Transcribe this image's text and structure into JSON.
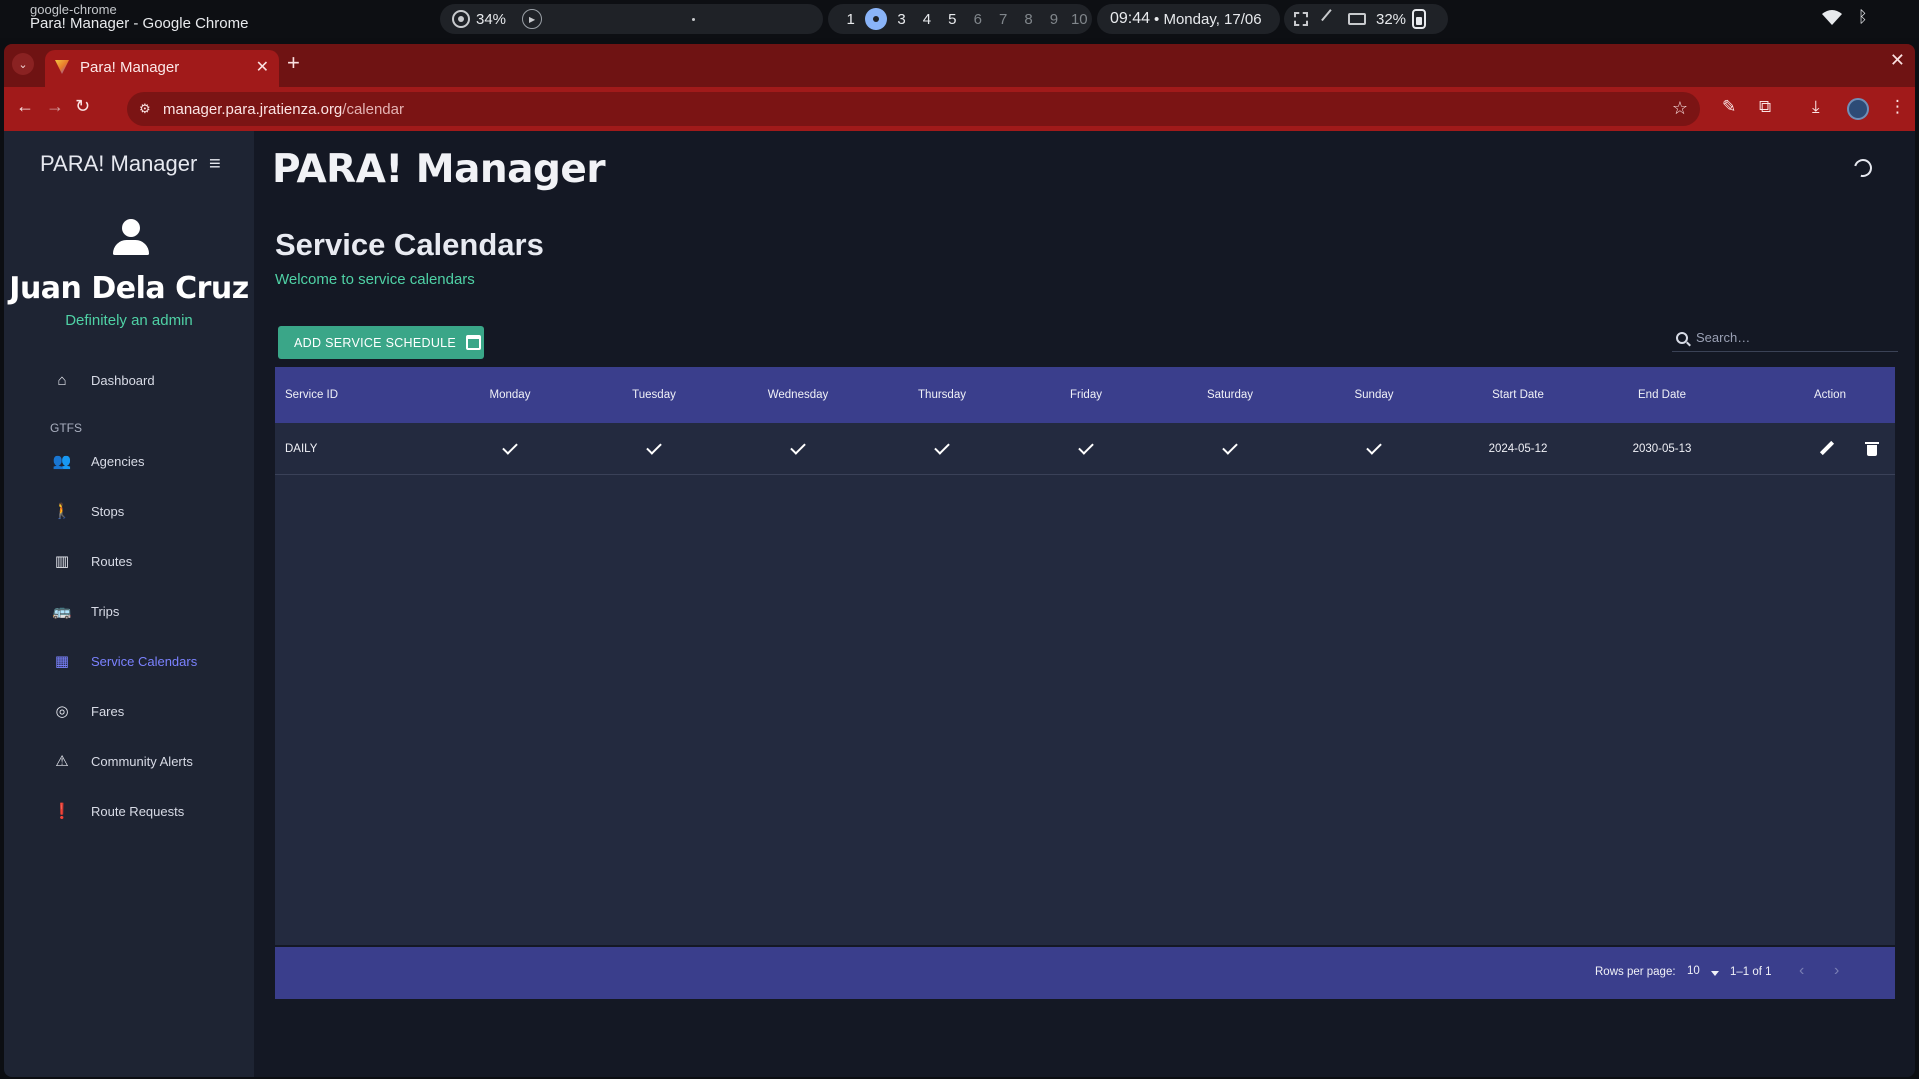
{
  "os": {
    "app_name": "google-chrome",
    "window_title": "Para! Manager - Google Chrome",
    "cpu": "34%",
    "workspaces": [
      "1",
      "2",
      "3",
      "4",
      "5",
      "6",
      "7",
      "8",
      "9",
      "10"
    ],
    "active_workspace": "2",
    "time": "09:44",
    "date": "• Monday, 17/06",
    "battery": "32%"
  },
  "browser": {
    "tab_title": "Para! Manager",
    "url_host": "manager.para.jratienza.org",
    "url_path": "/calendar",
    "theme_color": "#a11a1a"
  },
  "sidebar": {
    "brand": "PARA! Manager",
    "user_name": "Juan Dela Cruz",
    "user_role": "Definitely an admin",
    "section_label": "GTFS",
    "items": [
      {
        "label": "Dashboard",
        "icon": "home-icon"
      },
      {
        "label": "Agencies",
        "icon": "groups-icon"
      },
      {
        "label": "Stops",
        "icon": "person-walking-icon"
      },
      {
        "label": "Routes",
        "icon": "map-icon"
      },
      {
        "label": "Trips",
        "icon": "bus-icon"
      },
      {
        "label": "Service Calendars",
        "icon": "calendar-icon",
        "active": true
      },
      {
        "label": "Fares",
        "icon": "coins-icon"
      },
      {
        "label": "Community Alerts",
        "icon": "alert-bus-icon"
      },
      {
        "label": "Route Requests",
        "icon": "feedback-icon"
      }
    ]
  },
  "header": {
    "app_title": "PARA! Manager"
  },
  "main": {
    "page_title": "Service Calendars",
    "subtitle": "Welcome to service calendars",
    "add_button": "ADD SERVICE SCHEDULE",
    "search_placeholder": "Search…"
  },
  "table": {
    "columns": [
      "Service ID",
      "Monday",
      "Tuesday",
      "Wednesday",
      "Thursday",
      "Friday",
      "Saturday",
      "Sunday",
      "Start Date",
      "End Date",
      "Action"
    ],
    "rows": [
      {
        "service_id": "DAILY",
        "days": [
          true,
          true,
          true,
          true,
          true,
          true,
          true
        ],
        "start_date": "2024-05-12",
        "end_date": "2030-05-13"
      }
    ],
    "footer": {
      "rows_per_page_label": "Rows per page:",
      "rows_per_page": "10",
      "range": "1–1 of 1"
    }
  },
  "colors": {
    "accent_green": "#3aa688",
    "table_header": "#3a3e8c",
    "active_nav": "#7b82ff"
  }
}
